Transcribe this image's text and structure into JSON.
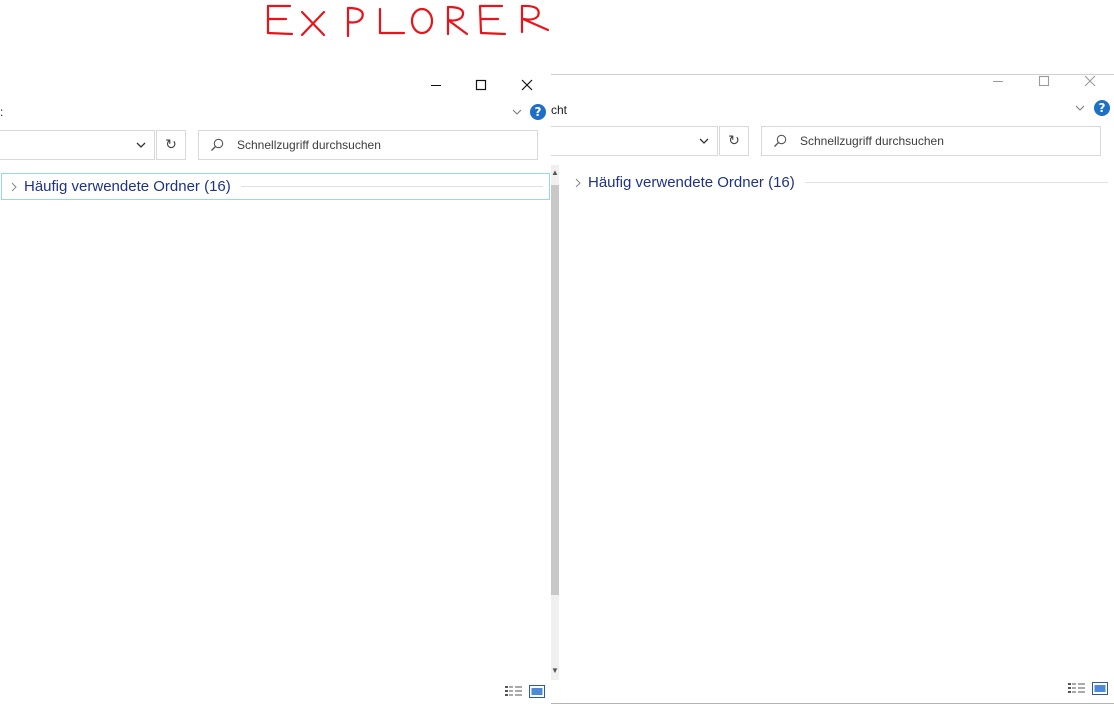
{
  "annotation": {
    "text": "EXPLORER",
    "color": "#e8141c"
  },
  "window_left": {
    "ribbon_fragment": ":",
    "search_placeholder": "Schnellzugriff durchsuchen",
    "group_label": "Häufig verwendete Ordner (16)",
    "help_label": "?",
    "refresh_glyph": "↻"
  },
  "window_right": {
    "ribbon_fragment": "cht",
    "search_placeholder": "Schnellzugriff durchsuchen",
    "group_label": "Häufig verwendete Ordner (16)",
    "help_label": "?",
    "refresh_glyph": "↻"
  },
  "icons": {
    "minimize": "minimize-icon",
    "maximize": "maximize-icon",
    "close": "close-icon",
    "search": "search-icon",
    "details_view": "details-view-icon",
    "large_icons_view": "large-icons-view-icon"
  },
  "colors": {
    "group_text": "#1e3287",
    "help": "#1e6fc6",
    "selection_border": "#99d1ff"
  }
}
